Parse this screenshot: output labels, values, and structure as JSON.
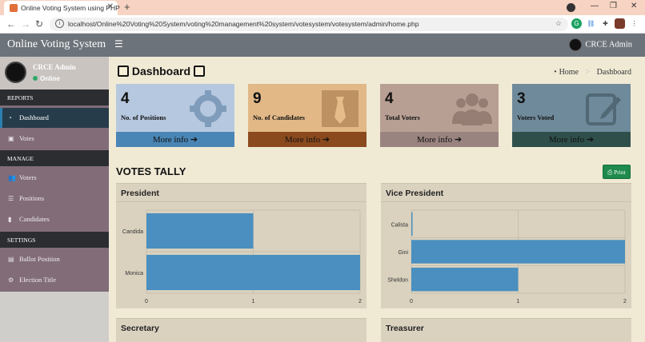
{
  "browser": {
    "tab_title": "Online Voting System using PHP",
    "url": "localhost/Online%20Voting%20System/voting%20management%20system/votesystem/votesystem/admin/home.php"
  },
  "header": {
    "brand": "Online Voting System",
    "user_name": "CRCE Admin"
  },
  "sidebar": {
    "user_name": "CRCE Admin",
    "status": "Online",
    "sections": [
      {
        "label": "REPORTS"
      },
      {
        "label": "MANAGE"
      },
      {
        "label": "SETTINGS"
      }
    ],
    "items": [
      {
        "label": "Dashboard",
        "icon": "dashboard-icon"
      },
      {
        "label": "Votes",
        "icon": "lock-icon"
      },
      {
        "label": "Voters",
        "icon": "users-icon"
      },
      {
        "label": "Positions",
        "icon": "tasks-icon"
      },
      {
        "label": "Candidates",
        "icon": "black-tie-icon"
      },
      {
        "label": "Ballot Position",
        "icon": "file-text-icon"
      },
      {
        "label": "Election Title",
        "icon": "cog-icon"
      }
    ]
  },
  "page": {
    "title": "Dashboard",
    "breadcrumb": {
      "home": "Home",
      "current": "Dashboard"
    }
  },
  "stats": [
    {
      "number": "4",
      "label": "No. of Positions",
      "footer": "More info",
      "bg": "#b6c8df",
      "footer_bg": "#4a86b5",
      "icon": "gear-icon"
    },
    {
      "number": "9",
      "label": "No. of Candidates",
      "footer": "More info",
      "bg": "#e2b887",
      "footer_bg": "#8a4a1e",
      "icon": "tie-icon"
    },
    {
      "number": "4",
      "label": "Total Voters",
      "footer": "More info",
      "bg": "#b89f93",
      "footer_bg": "#9a8480",
      "icon": "users-icon"
    },
    {
      "number": "3",
      "label": "Voters Voted",
      "footer": "More info",
      "bg": "#6f8a9a",
      "footer_bg": "#2f4f4a",
      "icon": "edit-icon"
    }
  ],
  "tally": {
    "title": "VOTES TALLY",
    "print_label": "Print"
  },
  "panels": [
    {
      "title": "President"
    },
    {
      "title": "Vice President"
    },
    {
      "title": "Secretary"
    },
    {
      "title": "Treasurer"
    }
  ],
  "chart_data": [
    {
      "type": "bar",
      "orientation": "horizontal",
      "title": "President",
      "categories": [
        "Candida",
        "Monica"
      ],
      "values": [
        1,
        2
      ],
      "xlim": [
        0,
        2
      ],
      "ticks": [
        0,
        1,
        2
      ],
      "grid": true,
      "color": "#4a8fbf"
    },
    {
      "type": "bar",
      "orientation": "horizontal",
      "title": "Vice President",
      "categories": [
        "Calista",
        "Gini",
        "Sheldon"
      ],
      "values": [
        0,
        2,
        1
      ],
      "xlim": [
        0,
        2
      ],
      "ticks": [
        0,
        1,
        2
      ],
      "grid": true,
      "color": "#4a8fbf"
    }
  ]
}
